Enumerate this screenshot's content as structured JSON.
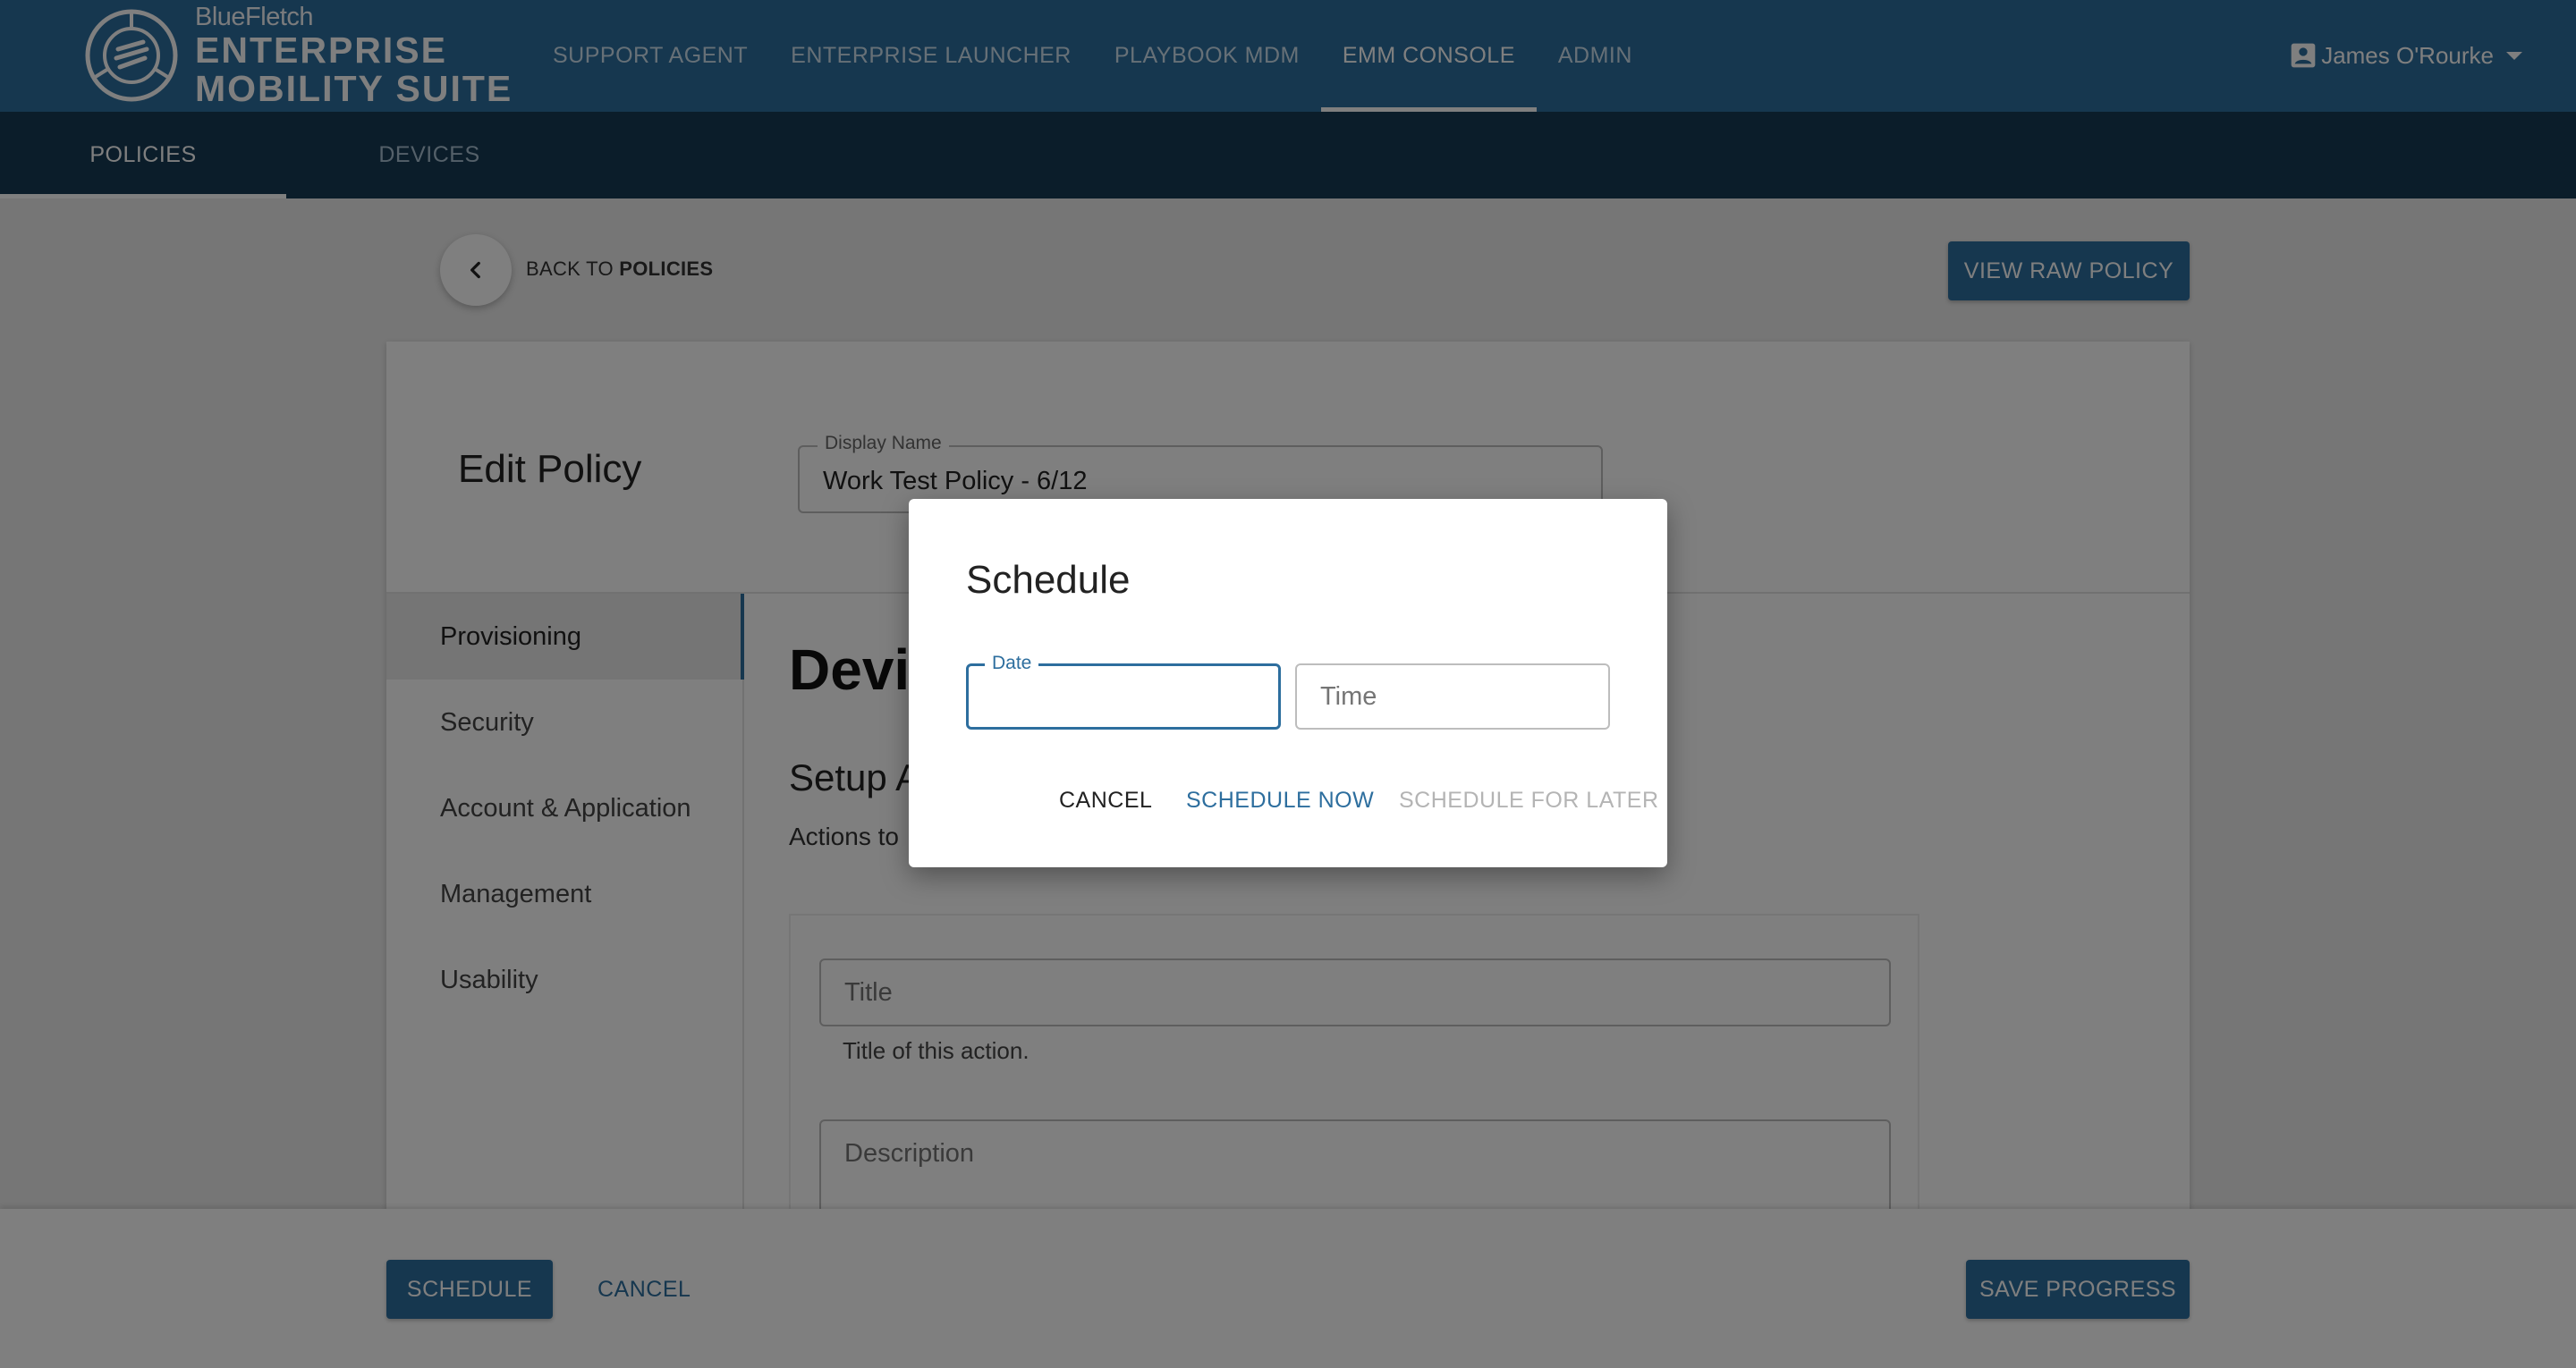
{
  "header": {
    "brand_small": "BlueFletch",
    "brand_line1": "ENTERPRISE",
    "brand_line2": "MOBILITY SUITE",
    "tabs": [
      {
        "label": "SUPPORT AGENT"
      },
      {
        "label": "ENTERPRISE LAUNCHER"
      },
      {
        "label": "PLAYBOOK MDM"
      },
      {
        "label": "EMM CONSOLE"
      },
      {
        "label": "ADMIN"
      }
    ],
    "user_name": "James O'Rourke"
  },
  "subnav": {
    "tabs": [
      {
        "label": "POLICIES"
      },
      {
        "label": "DEVICES"
      }
    ]
  },
  "toolbar": {
    "back_prefix": "BACK TO ",
    "back_target": "POLICIES",
    "view_raw_label": "VIEW RAW POLICY"
  },
  "policy": {
    "page_title": "Edit Policy",
    "display_name_label": "Display Name",
    "display_name_value": "Work Test Policy - 6/12",
    "side_items": [
      {
        "label": "Provisioning"
      },
      {
        "label": "Security"
      },
      {
        "label": "Account & Application"
      },
      {
        "label": "Management"
      },
      {
        "label": "Usability"
      }
    ],
    "section_title": "Devi",
    "section_subtitle": "Setup A",
    "section_description": "Actions to",
    "title_placeholder": "Title",
    "title_helper": "Title of this action.",
    "description_placeholder": "Description"
  },
  "footer": {
    "schedule_label": "SCHEDULE",
    "cancel_label": "CANCEL",
    "save_label": "SAVE PROGRESS"
  },
  "dialog": {
    "title": "Schedule",
    "date_label": "Date",
    "time_placeholder": "Time",
    "cancel_label": "CANCEL",
    "schedule_now_label": "SCHEDULE NOW",
    "schedule_later_label": "SCHEDULE FOR LATER"
  },
  "colors": {
    "primary": "#2d6e9e",
    "topbar": "#2d6e9e",
    "subbar": "#163a55",
    "disabled": "#b4b4b4"
  }
}
